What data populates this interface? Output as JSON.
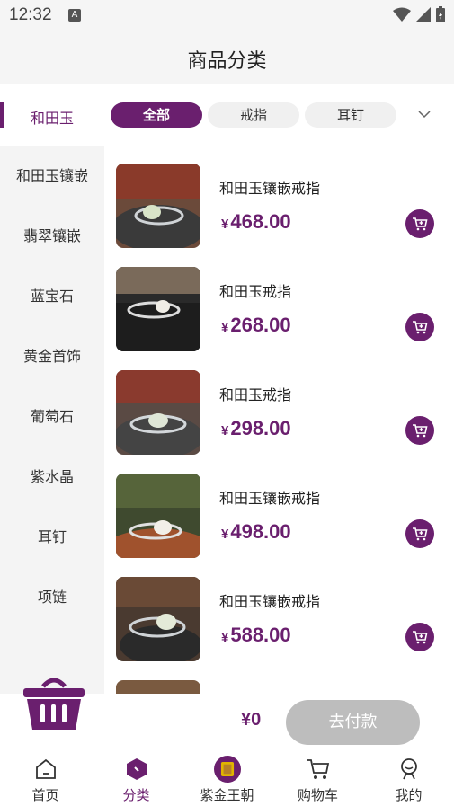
{
  "status_bar": {
    "time": "12:32",
    "notification_letter": "A"
  },
  "header": {
    "title": "商品分类"
  },
  "filter": {
    "selected_category": "和田玉",
    "chips": [
      {
        "label": "全部",
        "active": true
      },
      {
        "label": "戒指",
        "active": false
      },
      {
        "label": "耳钉",
        "active": false
      }
    ],
    "expand_icon": "chevron-down-icon"
  },
  "sidebar": {
    "items": [
      "和田玉镶嵌",
      "翡翠镶嵌",
      "蓝宝石",
      "黄金首饰",
      "葡萄石",
      "紫水晶",
      "耳钉",
      "项链"
    ]
  },
  "products": [
    {
      "name": "和田玉镶嵌戒指",
      "currency": "¥",
      "price": "468.00"
    },
    {
      "name": "和田玉戒指",
      "currency": "¥",
      "price": "268.00"
    },
    {
      "name": "和田玉戒指",
      "currency": "¥",
      "price": "298.00"
    },
    {
      "name": "和田玉镶嵌戒指",
      "currency": "¥",
      "price": "498.00"
    },
    {
      "name": "和田玉镶嵌戒指",
      "currency": "¥",
      "price": "588.00"
    }
  ],
  "checkout": {
    "total": "¥0",
    "pay_label": "去付款"
  },
  "tabbar": {
    "items": [
      {
        "label": "首页",
        "icon": "home-icon"
      },
      {
        "label": "分类",
        "icon": "category-icon"
      },
      {
        "label": "紫金王朝",
        "icon": "brand-logo-icon"
      },
      {
        "label": "购物车",
        "icon": "cart-icon"
      },
      {
        "label": "我的",
        "icon": "profile-icon"
      }
    ]
  },
  "colors": {
    "accent": "#6a1f6e",
    "disabled": "#bdbdbd"
  }
}
